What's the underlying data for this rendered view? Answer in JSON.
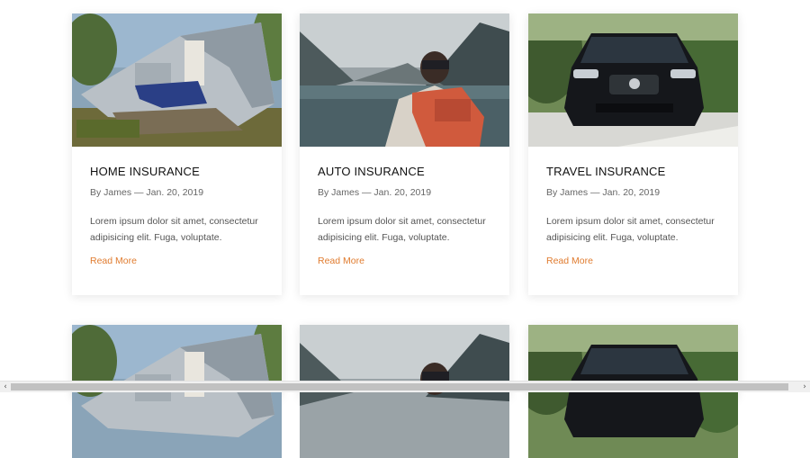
{
  "cards": [
    {
      "title": "HOME INSURANCE",
      "meta": "By James — Jan. 20, 2019",
      "excerpt": "Lorem ipsum dolor sit amet, consectetur adipisicing elit. Fuga, voluptate.",
      "link": "Read More",
      "image": "collapsed-house-photo"
    },
    {
      "title": "AUTO INSURANCE",
      "meta": "By James — Jan. 20, 2019",
      "excerpt": "Lorem ipsum dolor sit amet, consectetur adipisicing elit. Fuga, voluptate.",
      "link": "Read More",
      "image": "backpacker-lake-photo"
    },
    {
      "title": "TRAVEL INSURANCE",
      "meta": "By James — Jan. 20, 2019",
      "excerpt": "Lorem ipsum dolor sit amet, consectetur adipisicing elit. Fuga, voluptate.",
      "link": "Read More",
      "image": "black-sedan-photo"
    }
  ],
  "colors": {
    "accent": "#e07b2e",
    "title": "#111111",
    "meta": "#666666"
  },
  "scrollbar": {
    "left_icon": "‹",
    "right_icon": "›"
  }
}
